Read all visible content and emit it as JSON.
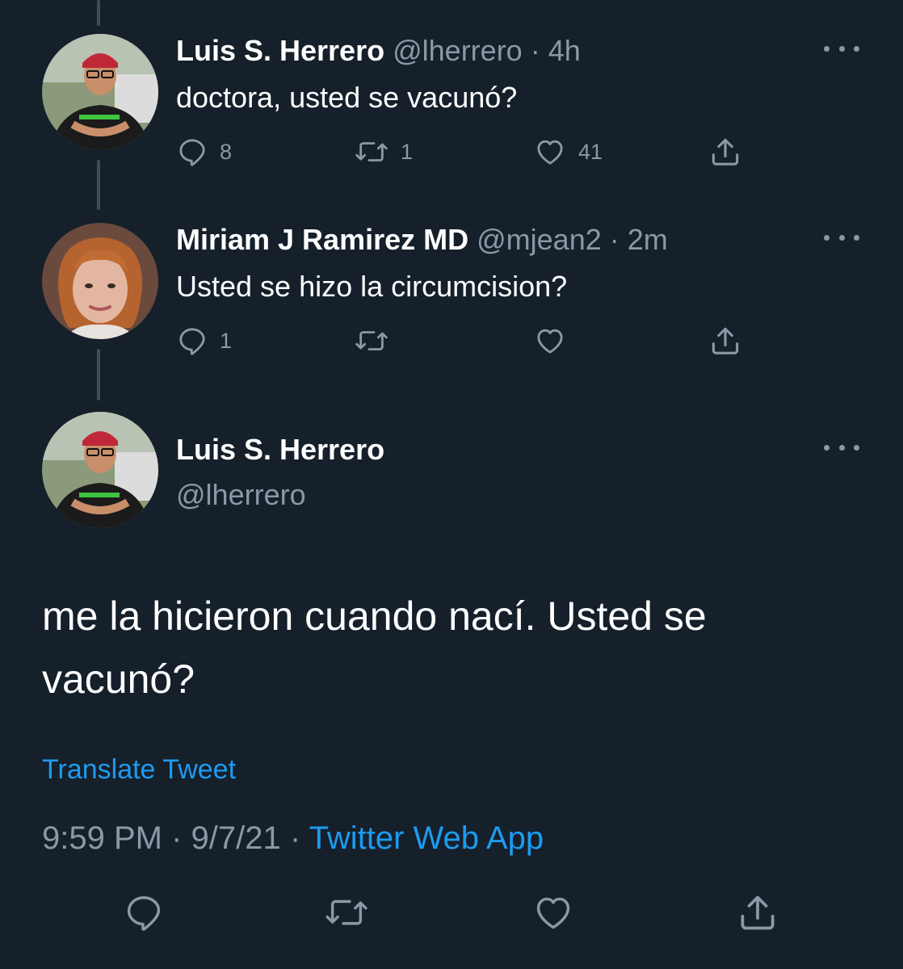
{
  "tweets": [
    {
      "author_name": "Luis S. Herrero",
      "handle": "@lherrero",
      "separator": "·",
      "time": "4h",
      "text": "doctora, usted se vacunó?",
      "reply_count": "8",
      "retweet_count": "1",
      "like_count": "41"
    },
    {
      "author_name": "Miriam J Ramirez MD",
      "handle": "@mjean2",
      "separator": "·",
      "time": "2m",
      "text": "Usted se hizo la circumcision?",
      "reply_count": "1",
      "retweet_count": "",
      "like_count": ""
    }
  ],
  "main_tweet": {
    "author_name": "Luis S. Herrero",
    "handle": "@lherrero",
    "text": "me la hicieron cuando nací. Usted se vacunó?",
    "translate_label": "Translate Tweet",
    "time": "9:59 PM",
    "separator1": "·",
    "date": "9/7/21",
    "separator2": "·",
    "source_app": "Twitter Web App"
  },
  "colors": {
    "background": "#15202b",
    "text_primary": "#ffffff",
    "text_secondary": "#8b98a5",
    "accent": "#1d9bf0",
    "thread_line": "#3d4f5c"
  },
  "icons": [
    "reply-icon",
    "retweet-icon",
    "like-icon",
    "share-icon",
    "more-icon"
  ]
}
